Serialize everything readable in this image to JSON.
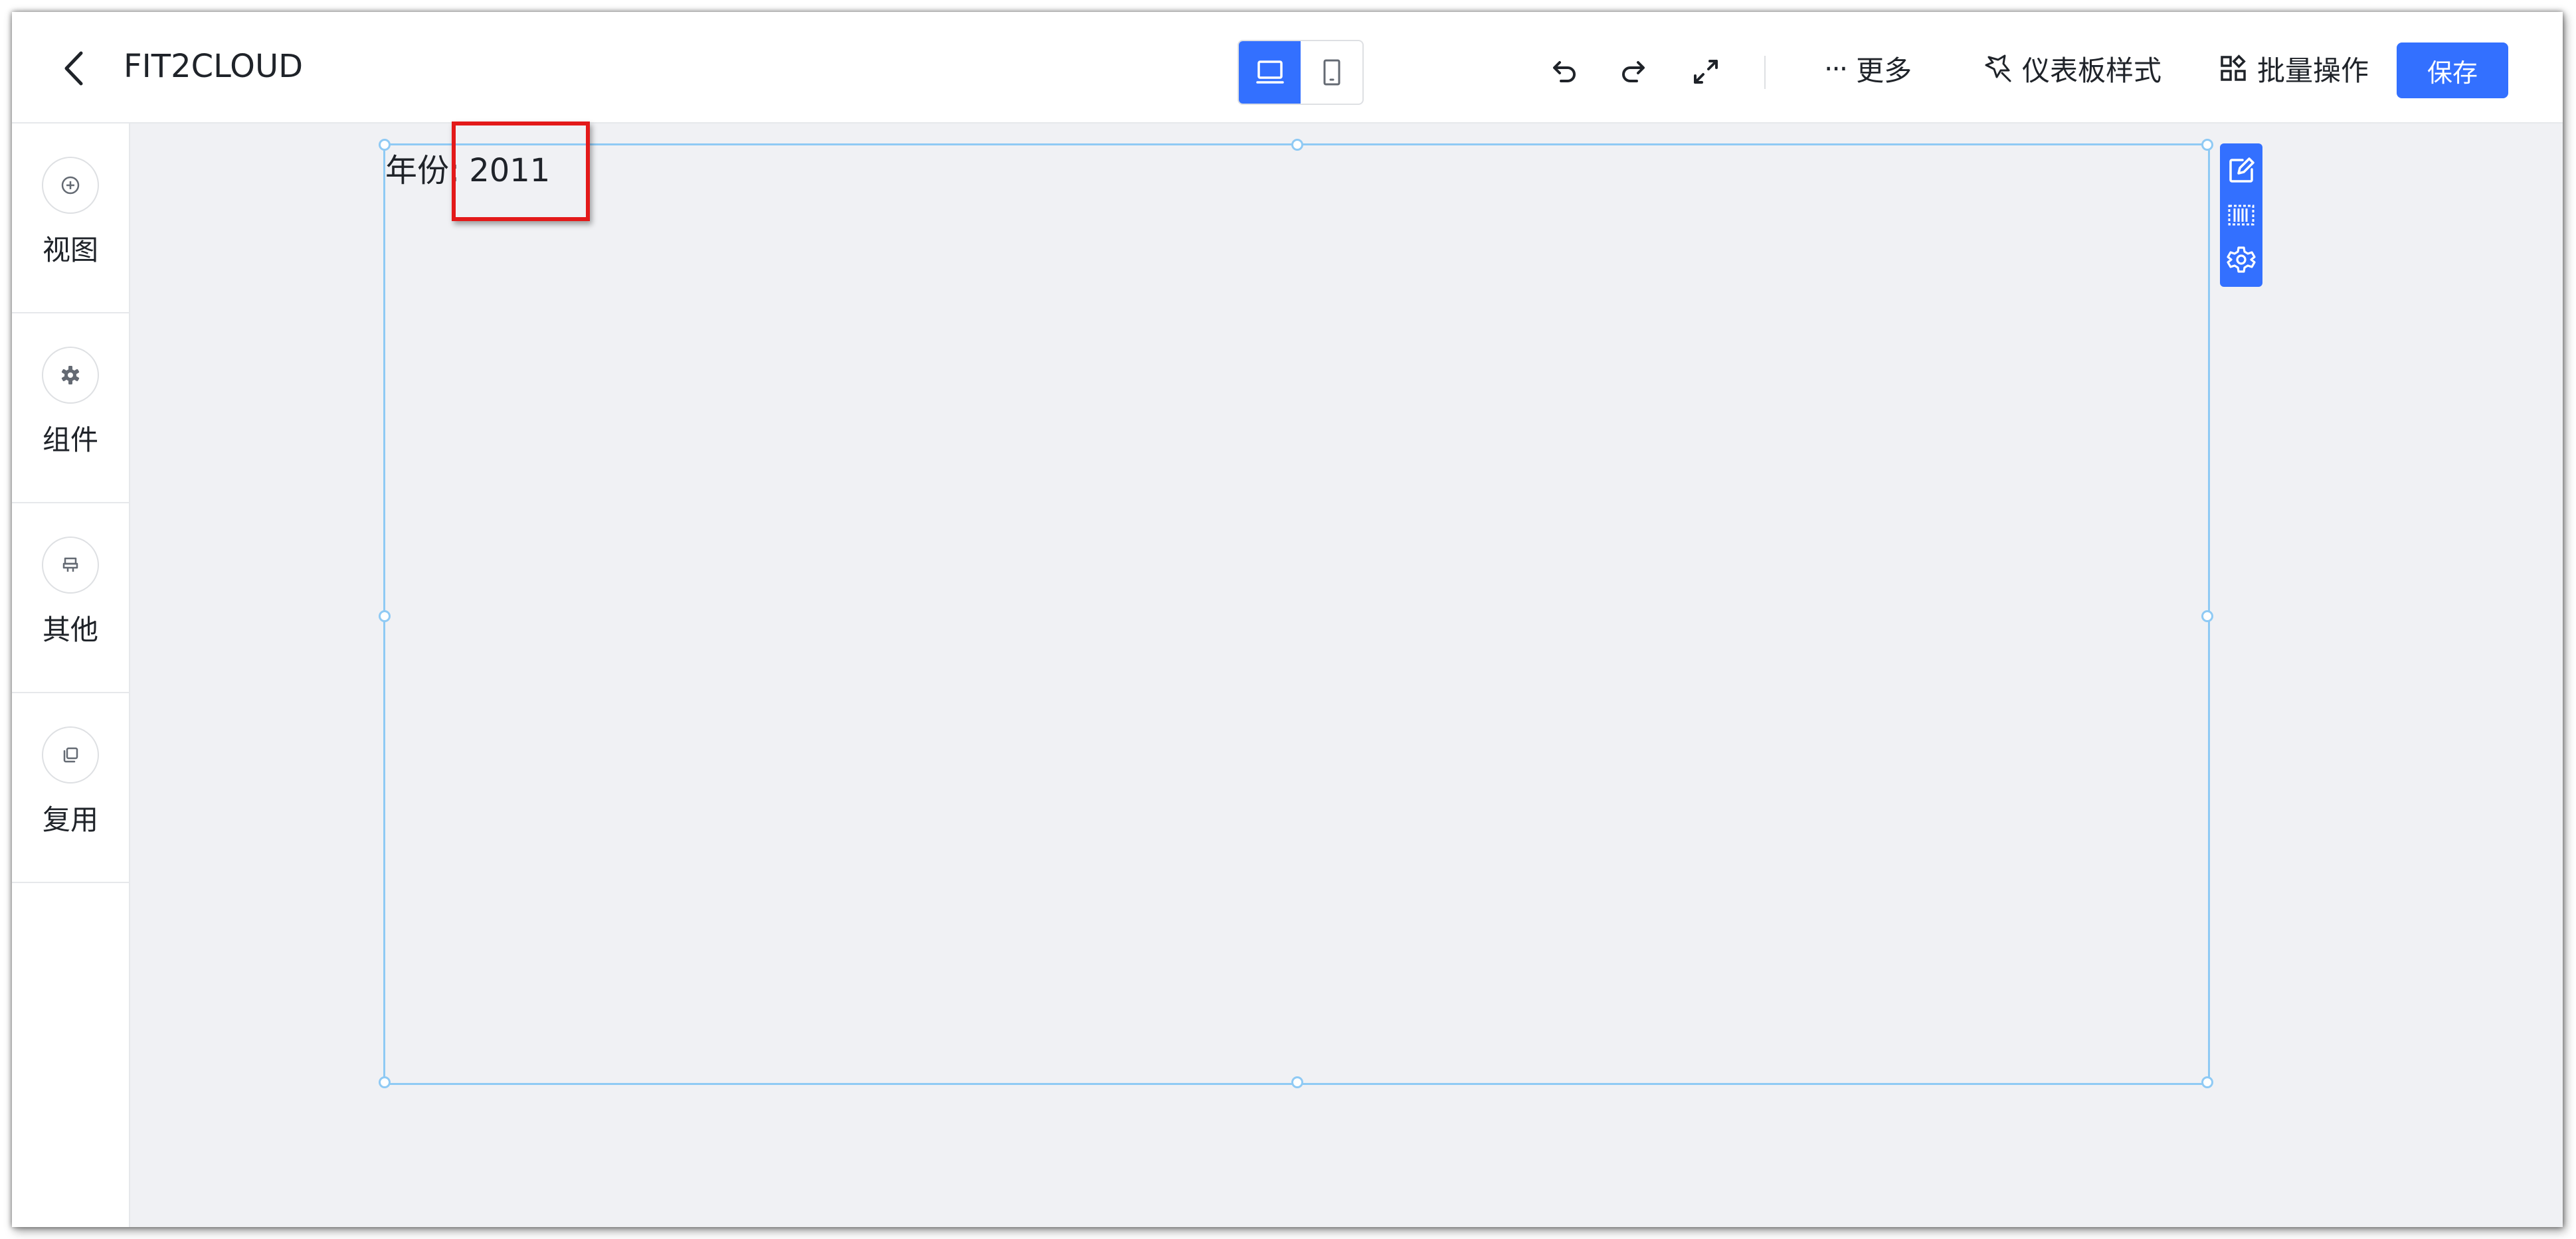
{
  "header": {
    "back_icon": "chevron-left-icon",
    "title": "FIT2CLOUD",
    "view_modes": [
      {
        "icon": "desktop-icon",
        "active": true
      },
      {
        "icon": "mobile-icon",
        "active": false
      }
    ],
    "tools": [
      "undo-icon",
      "redo-icon",
      "fullscreen-icon"
    ],
    "more_label": "更多",
    "more_icon": "ellipsis-icon",
    "style_label": "仪表板样式",
    "style_icon": "magic-wand-icon",
    "batch_label": "批量操作",
    "batch_icon": "grid-icon",
    "save_label": "保存",
    "accent_color": "#3370ff"
  },
  "sidebar": {
    "items": [
      {
        "label": "视图",
        "icon": "plus-circle-icon"
      },
      {
        "label": "组件",
        "icon": "gear-icon"
      },
      {
        "label": "其他",
        "icon": "stamp-icon"
      },
      {
        "label": "复用",
        "icon": "copy-icon"
      }
    ]
  },
  "canvas": {
    "background": "#f0f1f4",
    "widget": {
      "label": "年份:",
      "value": "2011",
      "border_color": "#8fcaf4",
      "toolbar_icons": [
        "edit-icon",
        "barcode-icon",
        "settings-icon"
      ]
    }
  }
}
